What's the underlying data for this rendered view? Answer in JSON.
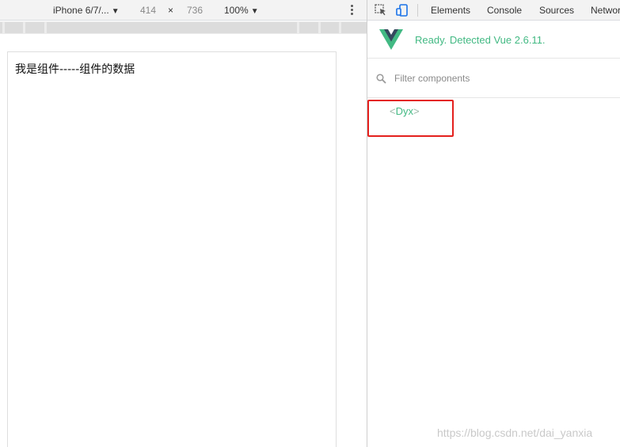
{
  "device_toolbar": {
    "device_name": "iPhone 6/7/...",
    "width": "414",
    "times": "×",
    "height": "736",
    "zoom": "100%"
  },
  "page": {
    "text": "我是组件-----组件的数据"
  },
  "devtools": {
    "tabs": [
      "Elements",
      "Console",
      "Sources",
      "Network"
    ],
    "vue_status": "Ready. Detected Vue 2.6.11.",
    "filter": {
      "placeholder": "Filter components",
      "value": ""
    },
    "tree": {
      "open_bracket": "<",
      "component": "Dyx",
      "close_bracket": ">"
    }
  },
  "watermark": "https://blog.csdn.net/dai_yanxia",
  "colors": {
    "vue_green": "#42b983",
    "vue_dark": "#35495e",
    "highlight_red": "#e4201d"
  }
}
